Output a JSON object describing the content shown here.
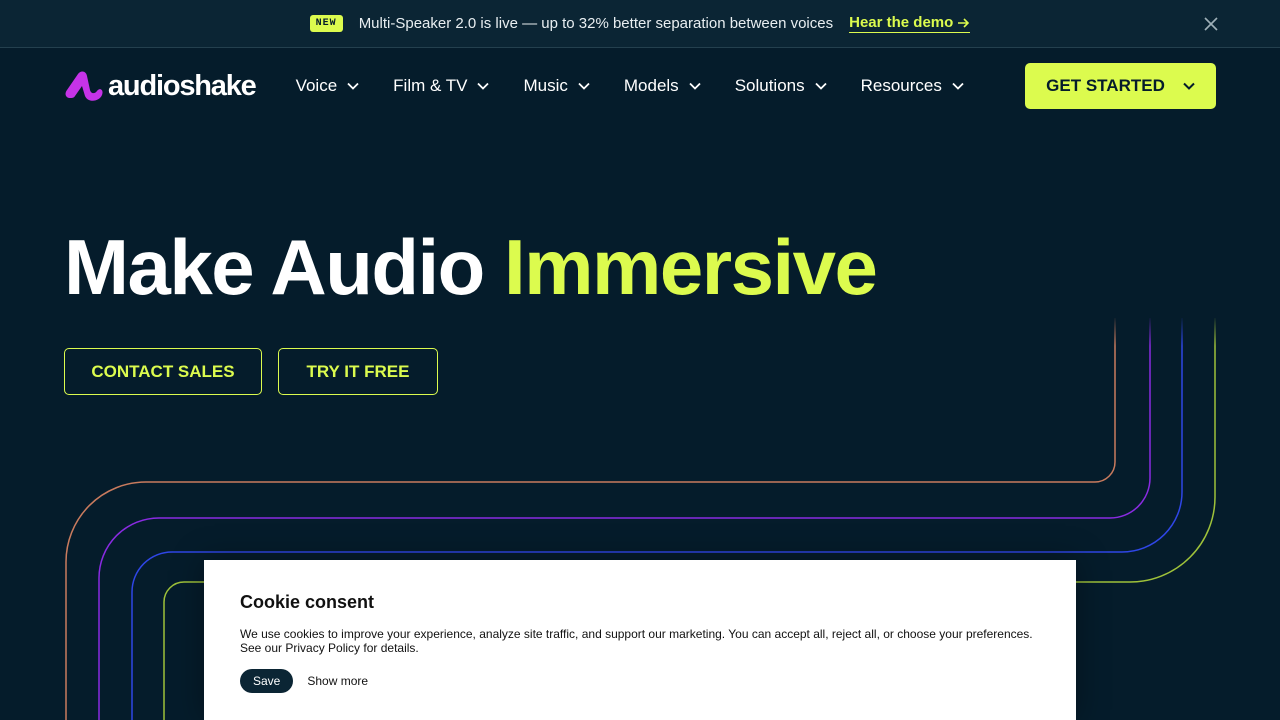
{
  "announcement": {
    "badge": "NEW",
    "text": "Multi-Speaker 2.0 is live — up to 32% better separation between voices",
    "link_label": "Hear the demo",
    "close_icon": "close-icon"
  },
  "brand": {
    "name": "audioshake",
    "logo_color": "#c633e8"
  },
  "nav": {
    "items": [
      {
        "label": "Voice"
      },
      {
        "label": "Film & TV"
      },
      {
        "label": "Music"
      },
      {
        "label": "Models"
      },
      {
        "label": "Solutions"
      },
      {
        "label": "Resources"
      }
    ],
    "cta_label": "GET STARTED"
  },
  "hero": {
    "title_part1": "Make Audio ",
    "title_part2": "Immersive",
    "contact_label": "CONTACT SALES",
    "try_label": "TRY IT FREE"
  },
  "cookie": {
    "title": "Cookie consent",
    "text_line1": "We use cookies to improve your experience, analyze site traffic, and support our marketing. You can accept all, reject all, or choose your preferences.",
    "text_line2": "See our Privacy Policy for details.",
    "save_label": "Save",
    "more_label": "Show more"
  },
  "colors": {
    "background": "#051c2b",
    "accent": "#dcfb4e",
    "line_orange": "#c97b5e",
    "line_purple": "#8a2be2",
    "line_blue": "#2f46e6",
    "line_lime": "#9fc23a"
  }
}
